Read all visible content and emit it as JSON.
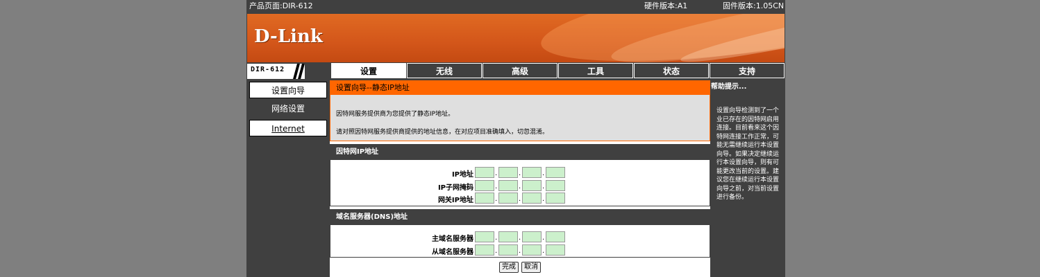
{
  "topbar": {
    "product": "产品页面:DIR-612",
    "hardware": "硬件版本:A1",
    "firmware": "固件版本:1.05CN"
  },
  "brand": {
    "logo": "D-Link",
    "model": "DIR-612"
  },
  "nav": {
    "tabs": [
      {
        "label": "设置",
        "active": true
      },
      {
        "label": "无线",
        "active": false
      },
      {
        "label": "高级",
        "active": false
      },
      {
        "label": "工具",
        "active": false
      },
      {
        "label": "状态",
        "active": false
      },
      {
        "label": "支持",
        "active": false
      }
    ]
  },
  "sidebar": {
    "items": [
      {
        "label": "设置向导"
      },
      {
        "label": "网络设置"
      },
      {
        "label": "Internet"
      }
    ]
  },
  "wizard": {
    "title": "设置向导--静态IP地址",
    "line1": "因特网服务提供商为您提供了静态IP地址。",
    "line2": "请对照因特网服务提供商提供的地址信息，在对应项目准确填入，切忽混淆。"
  },
  "internet_ip": {
    "title": "因特网IP地址",
    "fields": [
      {
        "label": "IP地址",
        "colon": ":"
      },
      {
        "label": "IP子网掩码",
        "colon": ":"
      },
      {
        "label": "网关IP地址",
        "colon": ":"
      }
    ]
  },
  "dns": {
    "title": "域名服务器(DNS)地址",
    "fields": [
      {
        "label": "主域名服务器",
        "colon": ":"
      },
      {
        "label": "从域名服务器",
        "colon": ":"
      }
    ]
  },
  "buttons": {
    "finish": "完成",
    "cancel": "取消"
  },
  "help": {
    "title": "帮助提示...",
    "text": "设置向导检测到了一个业已存在的因特网启用连接。目前看来这个因特网连接工作正常，可能无需继续运行本设置向导。如果决定继续运行本设置向导，则有可能更改当前的设置。建议您在继续运行本设置向导之前，对当前设置进行备份。"
  },
  "colors": {
    "accent": "#ff6600",
    "dark": "#404040",
    "input_bg": "#ccf0cc"
  }
}
